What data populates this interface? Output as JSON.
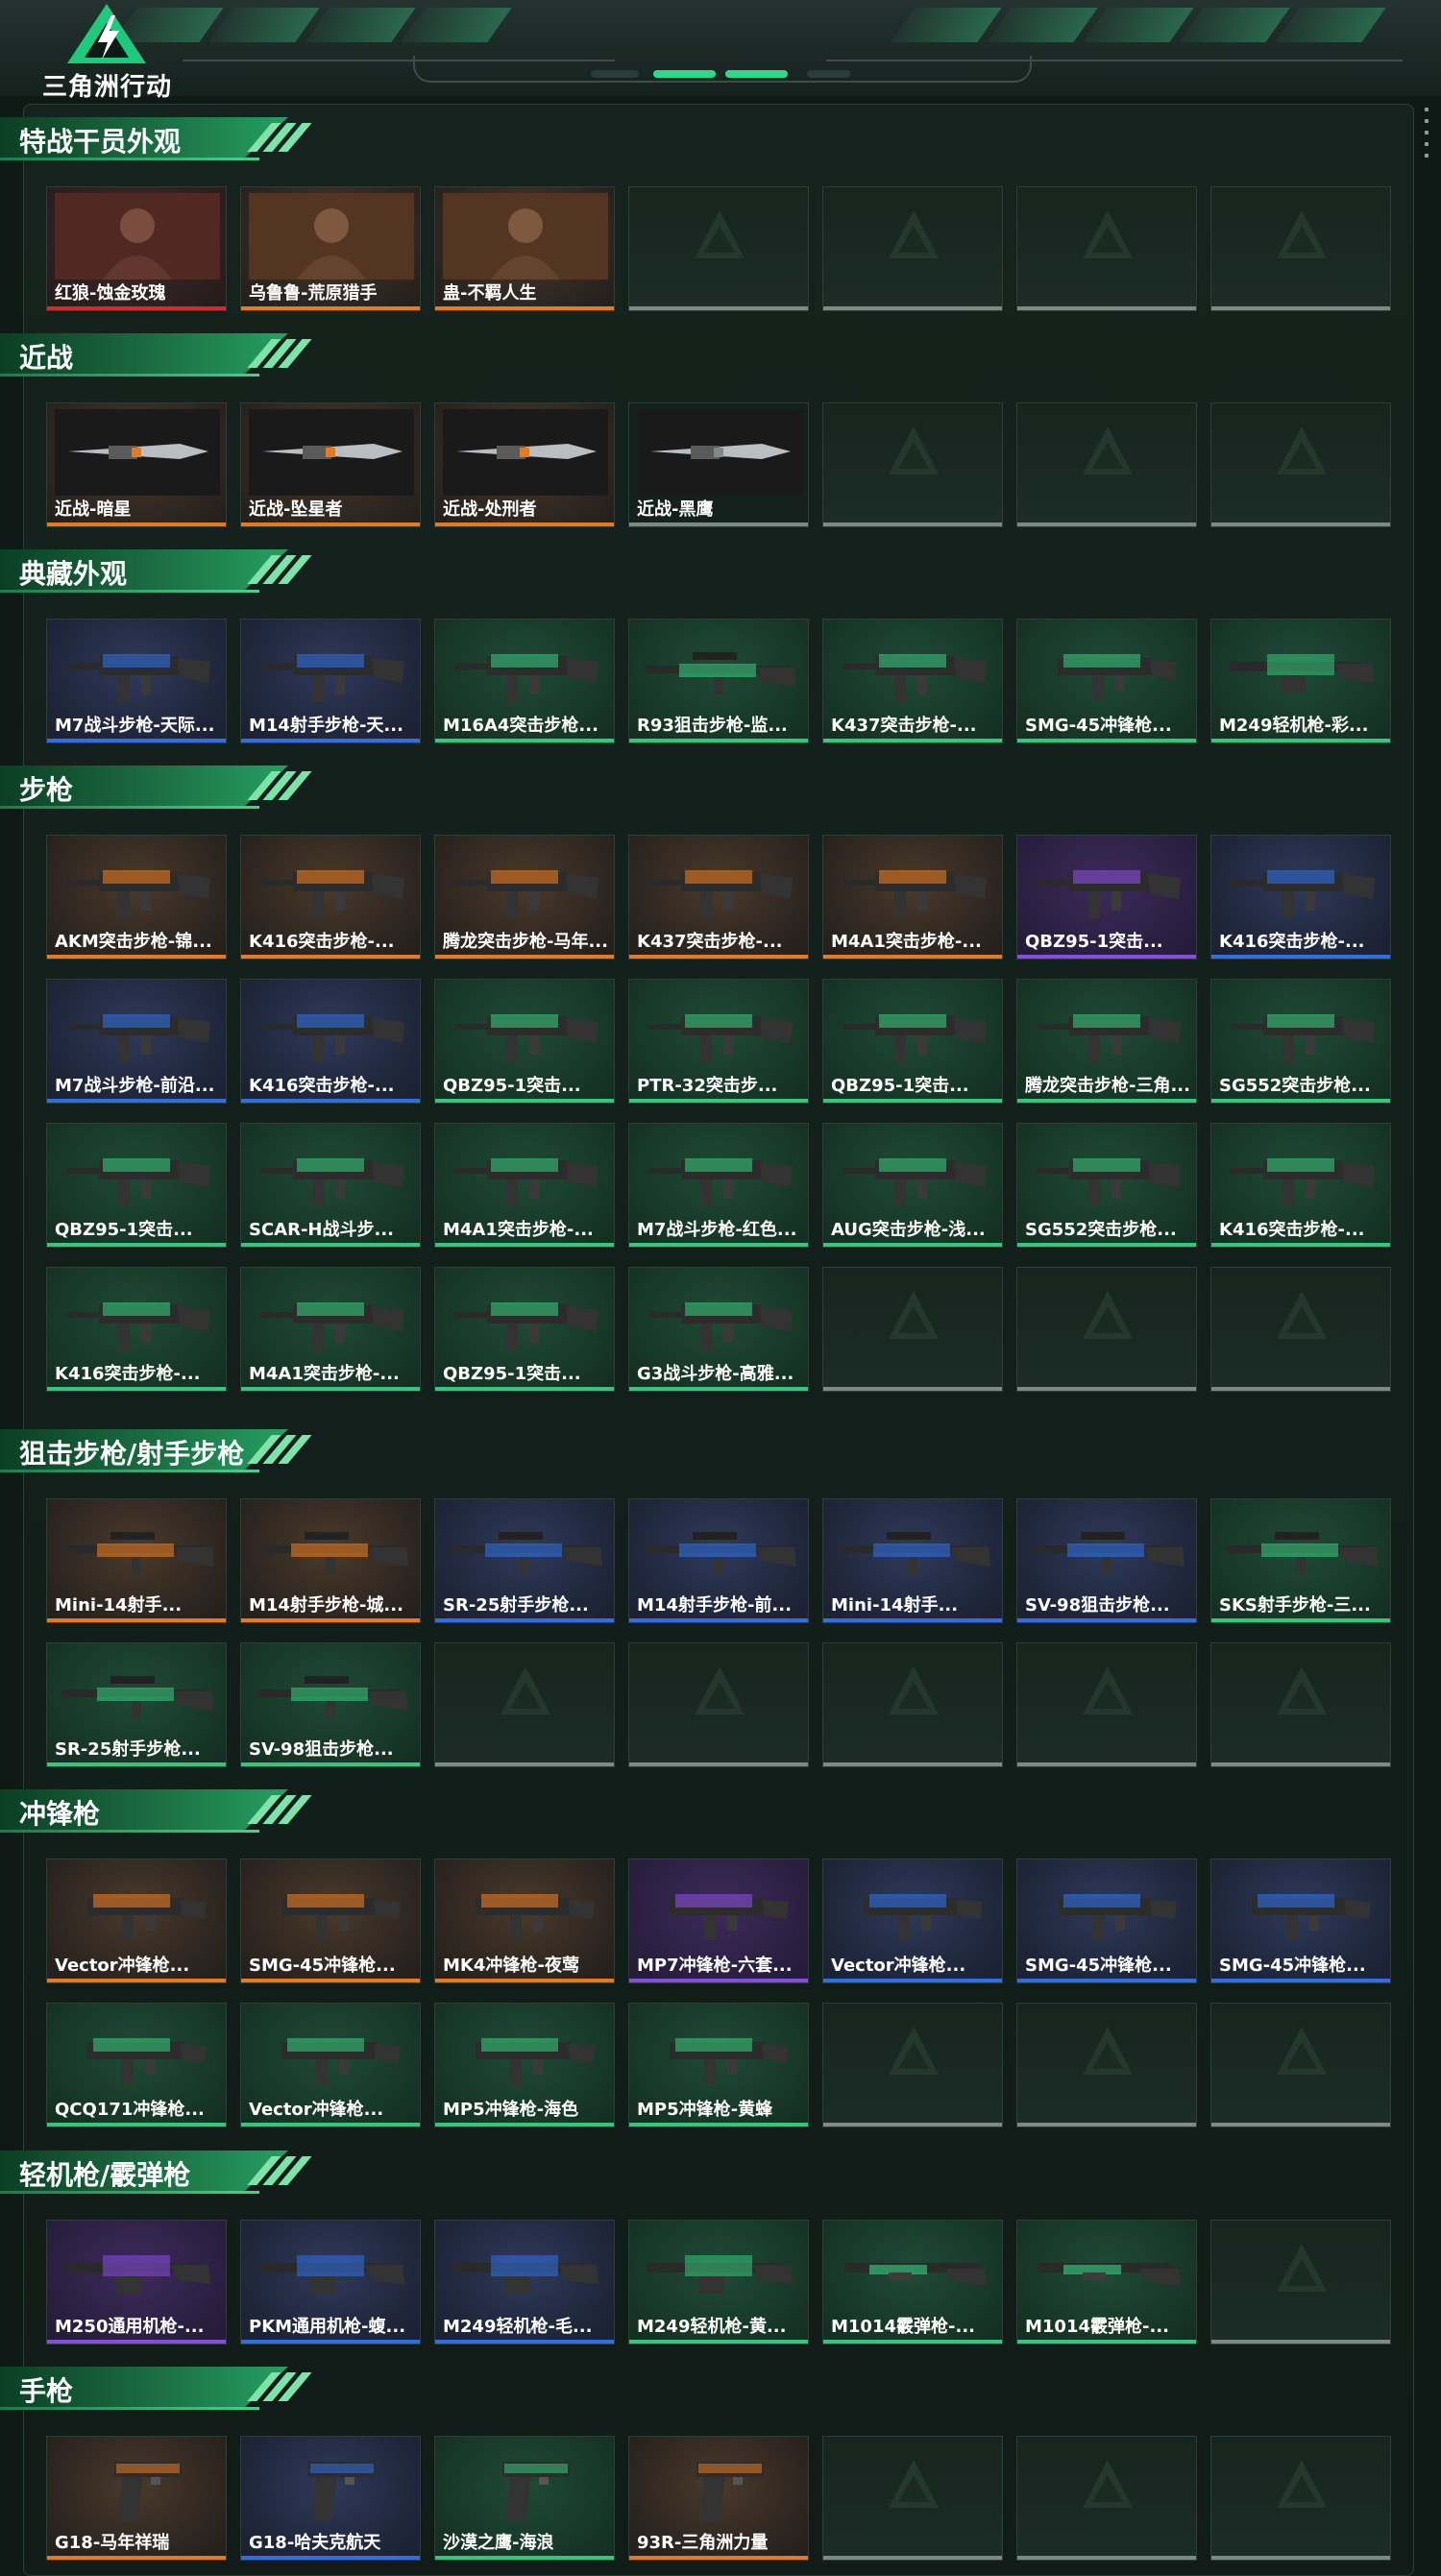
{
  "header": {
    "logo_text": "三角洲行动"
  },
  "colors": {
    "rarity": {
      "orange": "#e8791f",
      "blue": "#2f6fe6",
      "green": "#34c77a",
      "purple": "#8a4be0",
      "red": "#d62a2a",
      "gray": "#7f8a86"
    },
    "accent": "#24a062"
  },
  "sections": [
    {
      "title": "特战干员外观",
      "rows": [
        [
          {
            "name": "红狼-蚀金玫瑰",
            "rarity": "red",
            "icon": "operator-portrait"
          },
          {
            "name": "乌鲁鲁-荒原猎手",
            "rarity": "orange",
            "icon": "operator-portrait"
          },
          {
            "name": "蛊-不羁人生",
            "rarity": "orange",
            "icon": "operator-portrait"
          },
          {
            "empty": true
          },
          {
            "empty": true
          },
          {
            "empty": true
          },
          {
            "empty": true
          }
        ]
      ]
    },
    {
      "title": "近战",
      "rows": [
        [
          {
            "name": "近战-暗星",
            "rarity": "orange",
            "icon": "knife"
          },
          {
            "name": "近战-坠星者",
            "rarity": "orange",
            "icon": "knife"
          },
          {
            "name": "近战-处刑者",
            "rarity": "orange",
            "icon": "knife"
          },
          {
            "name": "近战-黑鹰",
            "rarity": "gray",
            "icon": "knife"
          },
          {
            "empty": true
          },
          {
            "empty": true
          },
          {
            "empty": true
          }
        ]
      ]
    },
    {
      "title": "典藏外观",
      "rows": [
        [
          {
            "name": "M7战斗步枪-天际...",
            "rarity": "blue",
            "icon": "rifle"
          },
          {
            "name": "M14射手步枪-天...",
            "rarity": "blue",
            "icon": "rifle"
          },
          {
            "name": "M16A4突击步枪...",
            "rarity": "green",
            "icon": "rifle"
          },
          {
            "name": "R93狙击步枪-监...",
            "rarity": "green",
            "icon": "sniper"
          },
          {
            "name": "K437突击步枪-...",
            "rarity": "green",
            "icon": "rifle"
          },
          {
            "name": "SMG-45冲锋枪...",
            "rarity": "green",
            "icon": "smg"
          },
          {
            "name": "M249轻机枪-彩...",
            "rarity": "green",
            "icon": "lmg"
          }
        ]
      ]
    },
    {
      "title": "步枪",
      "rows": [
        [
          {
            "name": "AKM突击步枪-锦...",
            "rarity": "orange",
            "icon": "rifle"
          },
          {
            "name": "K416突击步枪-...",
            "rarity": "orange",
            "icon": "rifle"
          },
          {
            "name": "腾龙突击步枪-马年...",
            "rarity": "orange",
            "icon": "rifle"
          },
          {
            "name": "K437突击步枪-...",
            "rarity": "orange",
            "icon": "rifle"
          },
          {
            "name": "M4A1突击步枪-...",
            "rarity": "orange",
            "icon": "rifle"
          },
          {
            "name": "QBZ95-1突击...",
            "rarity": "purple",
            "icon": "rifle"
          },
          {
            "name": "K416突击步枪-...",
            "rarity": "blue",
            "icon": "rifle"
          }
        ],
        [
          {
            "name": "M7战斗步枪-前沿...",
            "rarity": "blue",
            "icon": "rifle"
          },
          {
            "name": "K416突击步枪-...",
            "rarity": "blue",
            "icon": "rifle"
          },
          {
            "name": "QBZ95-1突击...",
            "rarity": "green",
            "icon": "rifle"
          },
          {
            "name": "PTR-32突击步...",
            "rarity": "green",
            "icon": "rifle"
          },
          {
            "name": "QBZ95-1突击...",
            "rarity": "green",
            "icon": "rifle"
          },
          {
            "name": "腾龙突击步枪-三角...",
            "rarity": "green",
            "icon": "rifle"
          },
          {
            "name": "SG552突击步枪...",
            "rarity": "green",
            "icon": "rifle"
          }
        ],
        [
          {
            "name": "QBZ95-1突击...",
            "rarity": "green",
            "icon": "rifle"
          },
          {
            "name": "SCAR-H战斗步...",
            "rarity": "green",
            "icon": "rifle"
          },
          {
            "name": "M4A1突击步枪-...",
            "rarity": "green",
            "icon": "rifle"
          },
          {
            "name": "M7战斗步枪-红色...",
            "rarity": "green",
            "icon": "rifle"
          },
          {
            "name": "AUG突击步枪-浅...",
            "rarity": "green",
            "icon": "rifle"
          },
          {
            "name": "SG552突击步枪...",
            "rarity": "green",
            "icon": "rifle"
          },
          {
            "name": "K416突击步枪-...",
            "rarity": "green",
            "icon": "rifle"
          }
        ],
        [
          {
            "name": "K416突击步枪-...",
            "rarity": "green",
            "icon": "rifle"
          },
          {
            "name": "M4A1突击步枪-...",
            "rarity": "green",
            "icon": "rifle"
          },
          {
            "name": "QBZ95-1突击...",
            "rarity": "green",
            "icon": "rifle"
          },
          {
            "name": "G3战斗步枪-高雅...",
            "rarity": "green",
            "icon": "rifle"
          },
          {
            "empty": true
          },
          {
            "empty": true
          },
          {
            "empty": true
          }
        ]
      ]
    },
    {
      "title": "狙击步枪/射手步枪",
      "rows": [
        [
          {
            "name": "Mini-14射手...",
            "rarity": "orange",
            "icon": "sniper"
          },
          {
            "name": "M14射手步枪-城...",
            "rarity": "orange",
            "icon": "sniper"
          },
          {
            "name": "SR-25射手步枪...",
            "rarity": "blue",
            "icon": "sniper"
          },
          {
            "name": "M14射手步枪-前...",
            "rarity": "blue",
            "icon": "sniper"
          },
          {
            "name": "Mini-14射手...",
            "rarity": "blue",
            "icon": "sniper"
          },
          {
            "name": "SV-98狙击步枪...",
            "rarity": "blue",
            "icon": "sniper"
          },
          {
            "name": "SKS射手步枪-三...",
            "rarity": "green",
            "icon": "sniper"
          }
        ],
        [
          {
            "name": "SR-25射手步枪...",
            "rarity": "green",
            "icon": "sniper"
          },
          {
            "name": "SV-98狙击步枪...",
            "rarity": "green",
            "icon": "sniper"
          },
          {
            "empty": true
          },
          {
            "empty": true
          },
          {
            "empty": true
          },
          {
            "empty": true
          },
          {
            "empty": true
          }
        ]
      ]
    },
    {
      "title": "冲锋枪",
      "rows": [
        [
          {
            "name": "Vector冲锋枪...",
            "rarity": "orange",
            "icon": "smg"
          },
          {
            "name": "SMG-45冲锋枪...",
            "rarity": "orange",
            "icon": "smg"
          },
          {
            "name": "MK4冲锋枪-夜莺",
            "rarity": "orange",
            "icon": "smg"
          },
          {
            "name": "MP7冲锋枪-六套...",
            "rarity": "purple",
            "icon": "smg"
          },
          {
            "name": "Vector冲锋枪...",
            "rarity": "blue",
            "icon": "smg"
          },
          {
            "name": "SMG-45冲锋枪...",
            "rarity": "blue",
            "icon": "smg"
          },
          {
            "name": "SMG-45冲锋枪...",
            "rarity": "blue",
            "icon": "smg"
          }
        ],
        [
          {
            "name": "QCQ171冲锋枪...",
            "rarity": "green",
            "icon": "smg"
          },
          {
            "name": "Vector冲锋枪...",
            "rarity": "green",
            "icon": "smg"
          },
          {
            "name": "MP5冲锋枪-海色",
            "rarity": "green",
            "icon": "smg"
          },
          {
            "name": "MP5冲锋枪-黄蜂",
            "rarity": "green",
            "icon": "smg"
          },
          {
            "empty": true
          },
          {
            "empty": true
          },
          {
            "empty": true
          }
        ]
      ]
    },
    {
      "title": "轻机枪/霰弹枪",
      "rows": [
        [
          {
            "name": "M250通用机枪-...",
            "rarity": "purple",
            "icon": "lmg"
          },
          {
            "name": "PKM通用机枪-蝮...",
            "rarity": "blue",
            "icon": "lmg"
          },
          {
            "name": "M249轻机枪-毛...",
            "rarity": "blue",
            "icon": "lmg"
          },
          {
            "name": "M249轻机枪-黄...",
            "rarity": "green",
            "icon": "lmg"
          },
          {
            "name": "M1014霰弹枪-...",
            "rarity": "green",
            "icon": "shotgun"
          },
          {
            "name": "M1014霰弹枪-...",
            "rarity": "green",
            "icon": "shotgun"
          },
          {
            "empty": true
          }
        ]
      ]
    },
    {
      "title": "手枪",
      "rows": [
        [
          {
            "name": "G18-马年祥瑞",
            "rarity": "orange",
            "icon": "pistol"
          },
          {
            "name": "G18-哈夫克航天",
            "rarity": "blue",
            "icon": "pistol"
          },
          {
            "name": "沙漠之鹰-海浪",
            "rarity": "green",
            "icon": "pistol"
          },
          {
            "name": "93R-三角洲力量",
            "rarity": "orange",
            "icon": "pistol"
          },
          {
            "empty": true
          },
          {
            "empty": true
          },
          {
            "empty": true
          }
        ]
      ]
    }
  ]
}
